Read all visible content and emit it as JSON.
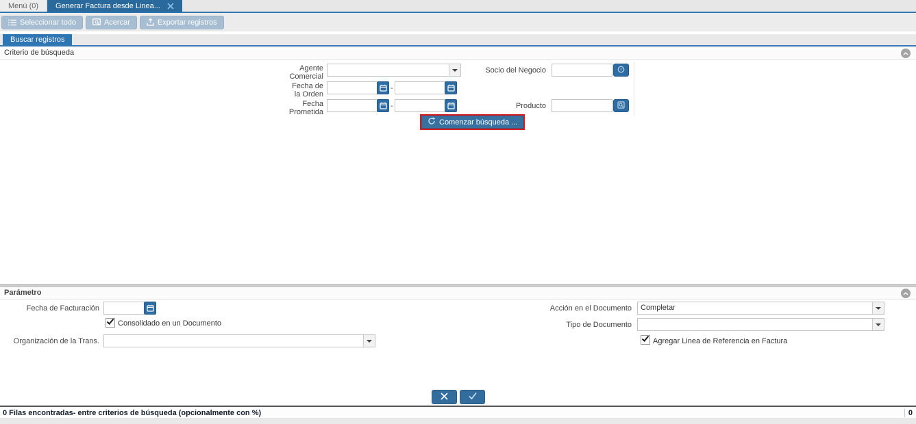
{
  "window_tabs": {
    "menu": {
      "label": "Menú (0)"
    },
    "active": {
      "label": "Generar Factura desde Linea..."
    }
  },
  "toolbar": {
    "buttons": [
      {
        "label": "Seleccionar todo",
        "icon": "select-all-icon"
      },
      {
        "label": "Acercar",
        "icon": "zoom-icon"
      },
      {
        "label": "Exportar registros",
        "icon": "export-icon"
      }
    ]
  },
  "content_tab": {
    "label": "Buscar registros"
  },
  "search_panel": {
    "title": "Criterio de búsqueda",
    "agente_label": "Agente Comercial",
    "agente_value": "",
    "socio_label": "Socio del Negocio",
    "socio_value": "",
    "fecha_orden_label": "Fecha de la Orden",
    "fecha_orden_from": "",
    "fecha_orden_to": "",
    "fecha_prometida_label": "Fecha Prometida",
    "fecha_prometida_from": "",
    "fecha_prometida_to": "",
    "producto_label": "Producto",
    "producto_value": "",
    "range_separator": "-",
    "search_button_label": "Comenzar búsqueda ...",
    "highlight_color": "#d61c1c"
  },
  "parameter_panel": {
    "title": "Parámetro",
    "fecha_facturacion_label": "Fecha de Facturación",
    "fecha_facturacion_value": "",
    "consolidado_label": "Consolidado en un Documento",
    "consolidado_checked": true,
    "organizacion_label": "Organización de la Trans.",
    "organizacion_value": "",
    "accion_label": "Acción en el Documento",
    "accion_value": "Completar",
    "tipo_label": "Tipo de Documento",
    "tipo_value": "",
    "agregar_label": "Agregar Linea de Referencia en Factura",
    "agregar_checked": true
  },
  "footer": {
    "status_text": "0 Filas encontradas- entre criterios de búsqueda (opcionalmente con %)",
    "status_right": "0"
  },
  "colors": {
    "accent_blue": "#2e6da4",
    "active_tab_blue": "#29699c",
    "content_tab_blue": "#2e76b3",
    "toolbar_button_blue": "#a6bdd2",
    "highlight_red": "#d61c1c"
  }
}
